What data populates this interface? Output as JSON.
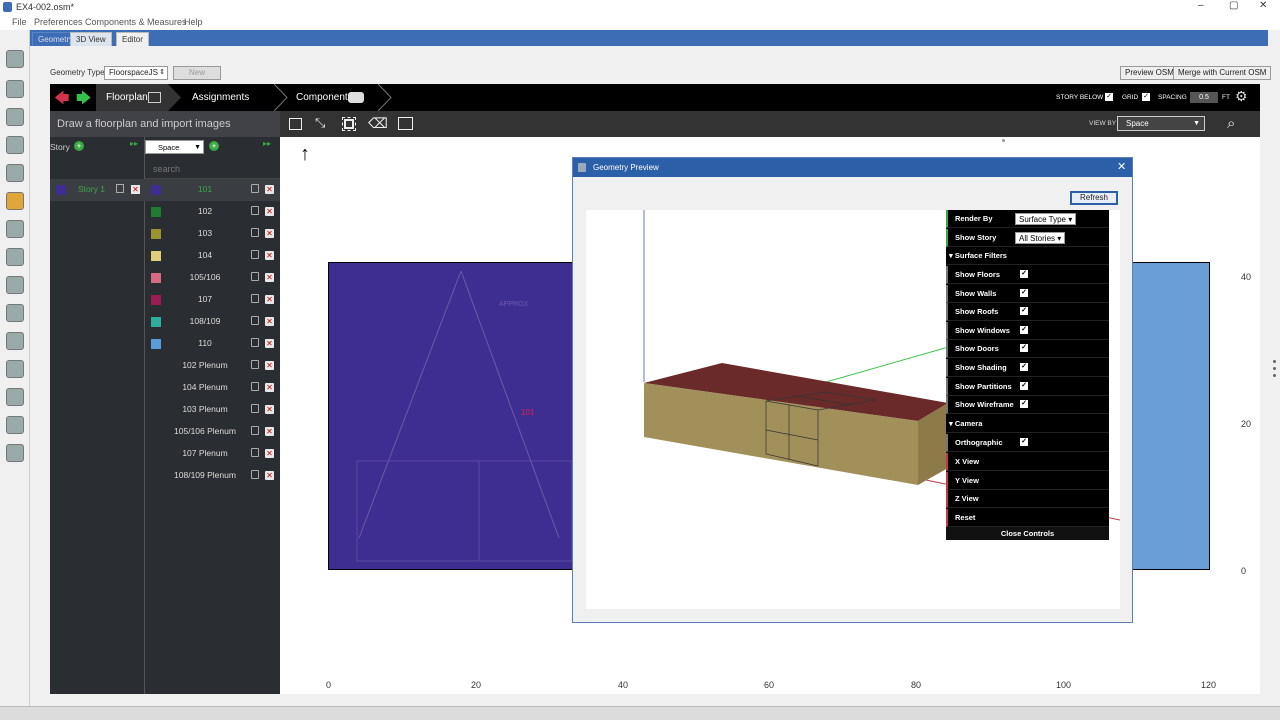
{
  "window": {
    "title": "EX4-002.osm*",
    "controls": [
      "–",
      "▢",
      "✕"
    ]
  },
  "menu": [
    "File",
    "Preferences",
    "Components & Measures",
    "Help"
  ],
  "tabs": [
    "Geometry",
    "3D View",
    "Editor"
  ],
  "geometry_type": {
    "label": "Geometry Type",
    "value": "FloorspaceJS",
    "new_label": "New"
  },
  "actions": {
    "preview": "Preview OSM",
    "merge": "Merge with Current OSM"
  },
  "nav": {
    "floorplan": "Floorplan",
    "assignments": "Assignments",
    "components": "Components"
  },
  "options": {
    "story_below": "STORY BELOW",
    "grid": "GRID",
    "spacing": "SPACING",
    "spacing_value": "0.5",
    "spacing_unit": "FT"
  },
  "viewby": {
    "label": "VIEW BY",
    "value": "Space"
  },
  "panel": {
    "instructions": "Draw a floorplan and import images",
    "story_header": "Story",
    "space_select": "Space",
    "search_placeholder": "search",
    "stories": [
      {
        "name": "Story 1",
        "color": "#3f2e91"
      }
    ],
    "spaces": [
      {
        "name": "101",
        "color": "#3f2e91"
      },
      {
        "name": "102",
        "color": "#1f7a32"
      },
      {
        "name": "103",
        "color": "#9a9330"
      },
      {
        "name": "104",
        "color": "#e3cf7b"
      },
      {
        "name": "105/106",
        "color": "#d56b80"
      },
      {
        "name": "107",
        "color": "#9a1d55"
      },
      {
        "name": "108/109",
        "color": "#2fae9f"
      },
      {
        "name": "110",
        "color": "#5b9bd8"
      },
      {
        "name": "102 Plenum",
        "color": ""
      },
      {
        "name": "104 Plenum",
        "color": ""
      },
      {
        "name": "103 Plenum",
        "color": ""
      },
      {
        "name": "105/106 Plenum",
        "color": ""
      },
      {
        "name": "107 Plenum",
        "color": ""
      },
      {
        "name": "108/109 Plenum",
        "color": ""
      }
    ]
  },
  "canvas": {
    "space_label": "101",
    "x_ticks": [
      "0",
      "20",
      "40",
      "60",
      "80",
      "100",
      "120"
    ],
    "y_ticks": [
      "40",
      "20",
      "0"
    ]
  },
  "dialog": {
    "title": "Geometry Preview",
    "refresh": "Refresh",
    "render_by_label": "Render By",
    "render_by_value": "Surface Type",
    "show_story_label": "Show Story",
    "show_story_value": "All Stories",
    "surface_filters": "Surface Filters",
    "filters": [
      "Show Floors",
      "Show Walls",
      "Show Roofs",
      "Show Windows",
      "Show Doors",
      "Show Shading",
      "Show Partitions",
      "Show Wireframe"
    ],
    "camera": "Camera",
    "orthographic": "Orthographic",
    "views": [
      "X View",
      "Y View",
      "Z View",
      "Reset"
    ],
    "close_controls": "Close Controls"
  }
}
